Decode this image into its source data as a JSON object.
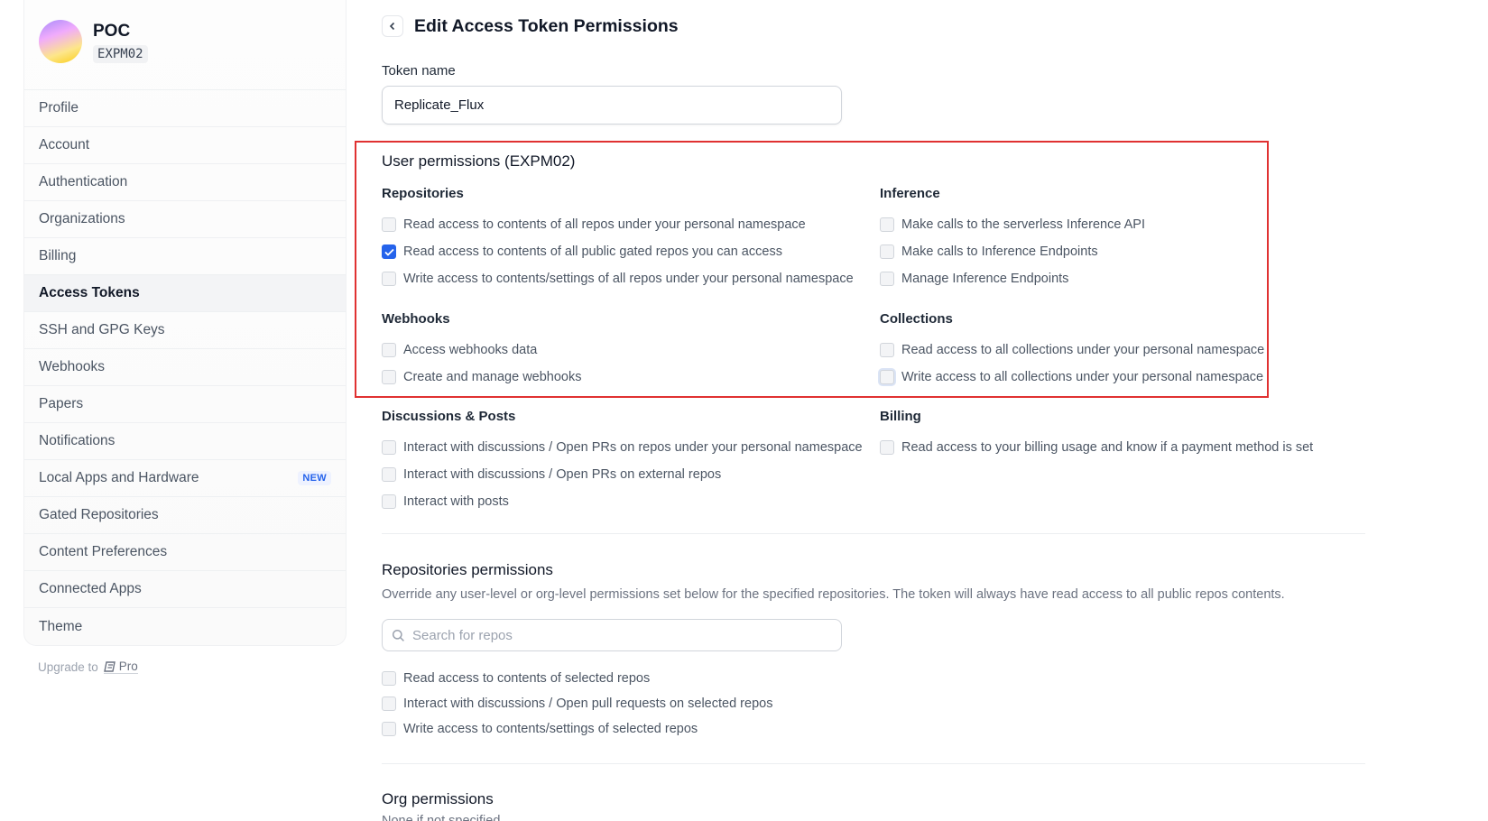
{
  "org": {
    "name": "POC",
    "handle": "EXPM02"
  },
  "sidebar": {
    "items": [
      {
        "label": "Profile"
      },
      {
        "label": "Account"
      },
      {
        "label": "Authentication"
      },
      {
        "label": "Organizations"
      },
      {
        "label": "Billing"
      },
      {
        "label": "Access Tokens",
        "active": true
      },
      {
        "label": "SSH and GPG Keys"
      },
      {
        "label": "Webhooks"
      },
      {
        "label": "Papers"
      },
      {
        "label": "Notifications"
      },
      {
        "label": "Local Apps and Hardware",
        "badge": "NEW"
      },
      {
        "label": "Gated Repositories"
      },
      {
        "label": "Content Preferences"
      },
      {
        "label": "Connected Apps"
      },
      {
        "label": "Theme"
      }
    ],
    "upgrade_label": "Upgrade to",
    "pro_label": "Pro"
  },
  "page": {
    "title": "Edit Access Token Permissions",
    "token_name_label": "Token name",
    "token_name_value": "Replicate_Flux"
  },
  "user_permissions": {
    "title": "User permissions (EXPM02)",
    "repositories": {
      "title": "Repositories",
      "options": [
        {
          "label": "Read access to contents of all repos under your personal namespace",
          "checked": false
        },
        {
          "label": "Read access to contents of all public gated repos you can access",
          "checked": true
        },
        {
          "label": "Write access to contents/settings of all repos under your personal namespace",
          "checked": false
        }
      ]
    },
    "inference": {
      "title": "Inference",
      "options": [
        {
          "label": "Make calls to the serverless Inference API",
          "checked": false
        },
        {
          "label": "Make calls to Inference Endpoints",
          "checked": false
        },
        {
          "label": "Manage Inference Endpoints",
          "checked": false
        }
      ]
    },
    "webhooks": {
      "title": "Webhooks",
      "options": [
        {
          "label": "Access webhooks data",
          "checked": false
        },
        {
          "label": "Create and manage webhooks",
          "checked": false
        }
      ]
    },
    "collections": {
      "title": "Collections",
      "options": [
        {
          "label": "Read access to all collections under your personal namespace",
          "checked": false
        },
        {
          "label": "Write access to all collections under your personal namespace",
          "checked": false
        }
      ]
    },
    "discussions": {
      "title": "Discussions & Posts",
      "options": [
        {
          "label": "Interact with discussions / Open PRs on repos under your personal namespace",
          "checked": false
        },
        {
          "label": "Interact with discussions / Open PRs on external repos",
          "checked": false
        },
        {
          "label": "Interact with posts",
          "checked": false
        }
      ]
    },
    "billing": {
      "title": "Billing",
      "options": [
        {
          "label": "Read access to your billing usage and know if a payment method is set",
          "checked": false
        }
      ]
    }
  },
  "repo_permissions": {
    "title": "Repositories permissions",
    "description": "Override any user-level or org-level permissions set below for the specified repositories. The token will always have read access to all public repos contents.",
    "search_placeholder": "Search for repos",
    "options": [
      {
        "label": "Read access to contents of selected repos",
        "checked": false
      },
      {
        "label": "Interact with discussions / Open pull requests on selected repos",
        "checked": false
      },
      {
        "label": "Write access to contents/settings of selected repos",
        "checked": false
      }
    ]
  },
  "org_permissions": {
    "title": "Org permissions",
    "subtitle": "None if not specified"
  },
  "colors": {
    "accent": "#2563eb",
    "highlight": "#e03131"
  }
}
